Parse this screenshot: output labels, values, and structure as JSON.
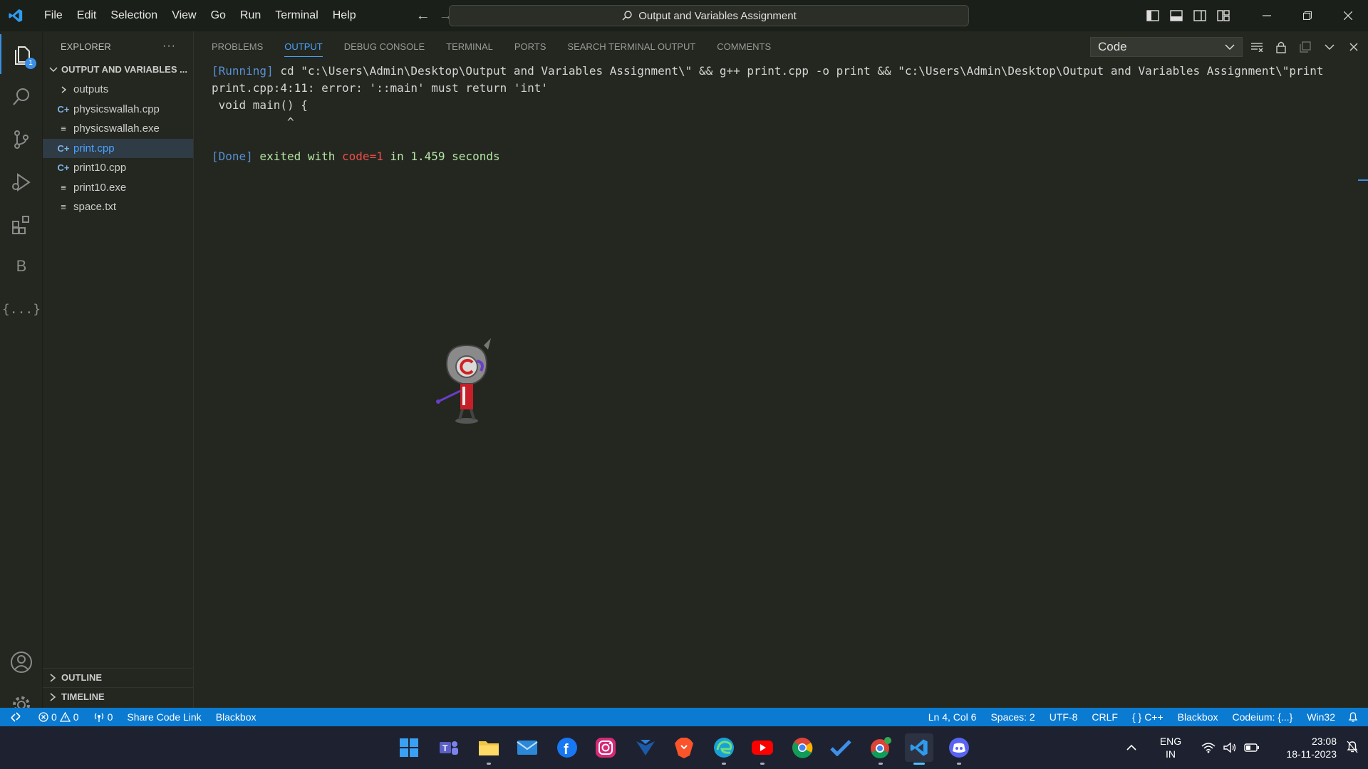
{
  "titlebar": {
    "menu": [
      "File",
      "Edit",
      "Selection",
      "View",
      "Go",
      "Run",
      "Terminal",
      "Help"
    ],
    "search_text": "Output and Variables Assignment"
  },
  "activitybar": {
    "explorer_badge": "1",
    "blackbox_letter": "B",
    "braces_label": "{...}"
  },
  "sidebar": {
    "title": "EXPLORER",
    "folder": "OUTPUT AND VARIABLES ...",
    "items": [
      {
        "label": "outputs",
        "icon": "chevron-right"
      },
      {
        "label": "physicswallah.cpp",
        "icon": "cpp"
      },
      {
        "label": "physicswallah.exe",
        "icon": "file-lines"
      },
      {
        "label": "print.cpp",
        "icon": "cpp"
      },
      {
        "label": "print10.cpp",
        "icon": "cpp"
      },
      {
        "label": "print10.exe",
        "icon": "file-lines"
      },
      {
        "label": "space.txt",
        "icon": "file-lines"
      }
    ],
    "outline": "OUTLINE",
    "timeline": "TIMELINE"
  },
  "panel": {
    "tabs": [
      "PROBLEMS",
      "OUTPUT",
      "DEBUG CONSOLE",
      "TERMINAL",
      "PORTS",
      "SEARCH TERMINAL OUTPUT",
      "COMMENTS"
    ],
    "active_tab": "OUTPUT",
    "channel": "Code",
    "output": {
      "running_tag": "[Running]",
      "command": " cd \"c:\\Users\\Admin\\Desktop\\Output and Variables Assignment\\\" && g++ print.cpp -o print && \"c:\\Users\\Admin\\Desktop\\Output and Variables Assignment\\\"print",
      "error_line": "print.cpp:4:11: error: '::main' must return 'int'",
      "code_line": " void main() {",
      "caret_line": "           ^",
      "done_tag": "[Done]",
      "done_text_1": " exited with ",
      "done_code": "code=1",
      "done_text_2": " in ",
      "done_time": "1.459",
      "done_text_3": " seconds"
    }
  },
  "statusbar": {
    "errors": "0",
    "warnings": "0",
    "ports": "0",
    "share": "Share Code Link",
    "blackbox": "Blackbox",
    "position": "Ln 4, Col 6",
    "spaces": "Spaces: 2",
    "encoding": "UTF-8",
    "eol": "CRLF",
    "language": "C++",
    "blackbox2": "Blackbox",
    "codeium": "Codeium: {...}",
    "platform": "Win32"
  },
  "taskbar": {
    "lang_line1": "ENG",
    "lang_line2": "IN",
    "time": "23:08",
    "date": "18-11-2023"
  },
  "colors": {
    "accent": "#0b7ad1",
    "error_red": "#f14c4c",
    "success_green": "#b5e4a6",
    "background": "#23271f"
  }
}
